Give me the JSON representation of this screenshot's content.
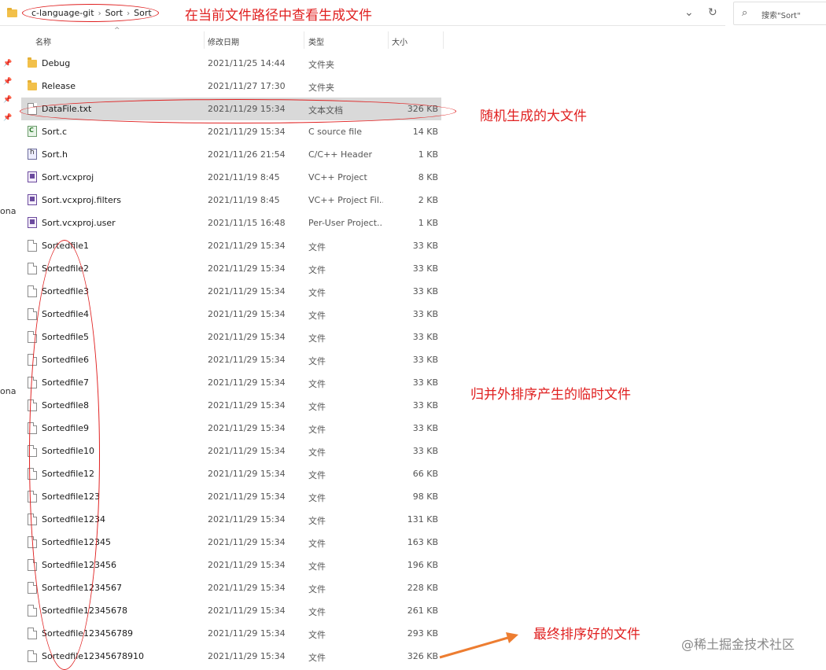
{
  "breadcrumb": [
    "c-language-git",
    "Sort",
    "Sort"
  ],
  "search_placeholder": "搜索\"Sort\"",
  "columns": {
    "name": "名称",
    "date": "修改日期",
    "type": "类型",
    "size": "大小"
  },
  "nav": {
    "label1": "ona",
    "label2": "ona"
  },
  "annotations": {
    "path_note": "在当前文件路径中查看生成文件",
    "big_file_note": "随机生成的大文件",
    "temp_files_note": "归并外排序产生的临时文件",
    "final_file_note": "最终排序好的文件"
  },
  "watermark": "@稀土掘金技术社区",
  "accent_color": "#e02020",
  "files": [
    {
      "name": "Debug",
      "date": "2021/11/25 14:44",
      "type": "文件夹",
      "size": "",
      "icon": "folder-icon"
    },
    {
      "name": "Release",
      "date": "2021/11/27 17:30",
      "type": "文件夹",
      "size": "",
      "icon": "folder-icon"
    },
    {
      "name": "DataFile.txt",
      "date": "2021/11/29 15:34",
      "type": "文本文档",
      "size": "326 KB",
      "icon": "text-file-icon",
      "selected": true
    },
    {
      "name": "Sort.c",
      "date": "2021/11/29 15:34",
      "type": "C source file",
      "size": "14 KB",
      "icon": "c-source-icon"
    },
    {
      "name": "Sort.h",
      "date": "2021/11/26 21:54",
      "type": "C/C++ Header",
      "size": "1 KB",
      "icon": "header-file-icon"
    },
    {
      "name": "Sort.vcxproj",
      "date": "2021/11/19 8:45",
      "type": "VC++ Project",
      "size": "8 KB",
      "icon": "project-file-icon"
    },
    {
      "name": "Sort.vcxproj.filters",
      "date": "2021/11/19 8:45",
      "type": "VC++ Project Fil...",
      "size": "2 KB",
      "icon": "project-file-icon"
    },
    {
      "name": "Sort.vcxproj.user",
      "date": "2021/11/15 16:48",
      "type": "Per-User Project...",
      "size": "1 KB",
      "icon": "project-file-icon"
    },
    {
      "name": "Sortedfile1",
      "date": "2021/11/29 15:34",
      "type": "文件",
      "size": "33 KB",
      "icon": "file-icon"
    },
    {
      "name": "Sortedfile2",
      "date": "2021/11/29 15:34",
      "type": "文件",
      "size": "33 KB",
      "icon": "file-icon"
    },
    {
      "name": "Sortedfile3",
      "date": "2021/11/29 15:34",
      "type": "文件",
      "size": "33 KB",
      "icon": "file-icon"
    },
    {
      "name": "Sortedfile4",
      "date": "2021/11/29 15:34",
      "type": "文件",
      "size": "33 KB",
      "icon": "file-icon"
    },
    {
      "name": "Sortedfile5",
      "date": "2021/11/29 15:34",
      "type": "文件",
      "size": "33 KB",
      "icon": "file-icon"
    },
    {
      "name": "Sortedfile6",
      "date": "2021/11/29 15:34",
      "type": "文件",
      "size": "33 KB",
      "icon": "file-icon"
    },
    {
      "name": "Sortedfile7",
      "date": "2021/11/29 15:34",
      "type": "文件",
      "size": "33 KB",
      "icon": "file-icon"
    },
    {
      "name": "Sortedfile8",
      "date": "2021/11/29 15:34",
      "type": "文件",
      "size": "33 KB",
      "icon": "file-icon"
    },
    {
      "name": "Sortedfile9",
      "date": "2021/11/29 15:34",
      "type": "文件",
      "size": "33 KB",
      "icon": "file-icon"
    },
    {
      "name": "Sortedfile10",
      "date": "2021/11/29 15:34",
      "type": "文件",
      "size": "33 KB",
      "icon": "file-icon"
    },
    {
      "name": "Sortedfile12",
      "date": "2021/11/29 15:34",
      "type": "文件",
      "size": "66 KB",
      "icon": "file-icon"
    },
    {
      "name": "Sortedfile123",
      "date": "2021/11/29 15:34",
      "type": "文件",
      "size": "98 KB",
      "icon": "file-icon"
    },
    {
      "name": "Sortedfile1234",
      "date": "2021/11/29 15:34",
      "type": "文件",
      "size": "131 KB",
      "icon": "file-icon"
    },
    {
      "name": "Sortedfile12345",
      "date": "2021/11/29 15:34",
      "type": "文件",
      "size": "163 KB",
      "icon": "file-icon"
    },
    {
      "name": "Sortedfile123456",
      "date": "2021/11/29 15:34",
      "type": "文件",
      "size": "196 KB",
      "icon": "file-icon"
    },
    {
      "name": "Sortedfile1234567",
      "date": "2021/11/29 15:34",
      "type": "文件",
      "size": "228 KB",
      "icon": "file-icon"
    },
    {
      "name": "Sortedfile12345678",
      "date": "2021/11/29 15:34",
      "type": "文件",
      "size": "261 KB",
      "icon": "file-icon"
    },
    {
      "name": "Sortedfile123456789",
      "date": "2021/11/29 15:34",
      "type": "文件",
      "size": "293 KB",
      "icon": "file-icon"
    },
    {
      "name": "Sortedfile12345678910",
      "date": "2021/11/29 15:34",
      "type": "文件",
      "size": "326 KB",
      "icon": "file-icon"
    }
  ]
}
